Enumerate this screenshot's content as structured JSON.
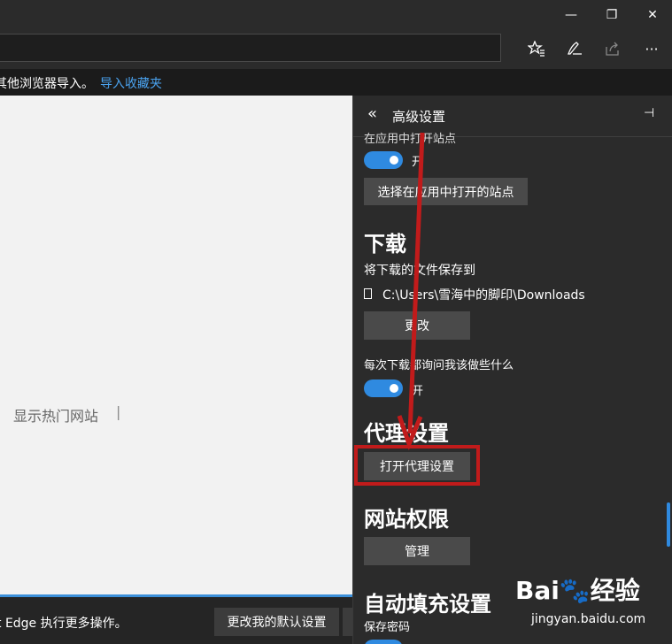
{
  "window": {
    "minimize": "—",
    "restore": "❐",
    "close": "✕"
  },
  "toolbar": {
    "icons": [
      "favorites-icon",
      "notes-icon",
      "share-icon",
      "more-icon"
    ],
    "more": "···"
  },
  "favorites_bar": {
    "text": "其他浏览器导入。",
    "link": "导入收藏夹"
  },
  "content": {
    "hot_sites": "显示热门网站",
    "cursor": "|"
  },
  "bottom_bar": {
    "text": "t Edge 执行更多操作。",
    "button": "更改我的默认设置"
  },
  "panel": {
    "title": "高级设置",
    "back": "«",
    "pin": "⊣",
    "partial_text": "在应用中打开站点",
    "toggle1_label": "开",
    "button_sites": "选择在应用中打开的站点",
    "downloads_heading": "下载",
    "save_to_label": "将下载的文件保存到",
    "download_path": "C:\\Users\\雪海中的脚印\\Downloads",
    "change_button": "更改",
    "ask_label": "每次下载都询问我该做些什么",
    "toggle2_label": "开",
    "proxy_heading": "代理设置",
    "proxy_button": "打开代理设置",
    "permissions_heading": "网站权限",
    "manage_button": "管理",
    "autofill_heading": "自动填充设置",
    "save_password_label": "保存密码"
  },
  "watermark": {
    "brand": "Bai🐾经验",
    "url": "jingyan.baidu.com"
  },
  "colors": {
    "accent": "#2f8ae0",
    "highlight": "#c11b1b",
    "link": "#4aa3f0"
  }
}
